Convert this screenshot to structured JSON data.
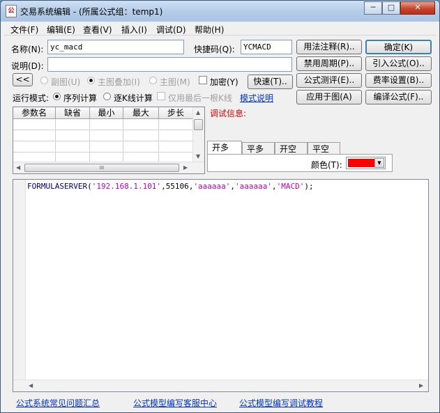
{
  "window": {
    "title": "交易系统编辑 - (所属公式组：temp1)",
    "icon_text": "公"
  },
  "window_controls": {
    "minimize": "─",
    "maximize": "□",
    "close": "✕"
  },
  "menu": [
    "文件(F)",
    "编辑(E)",
    "查看(V)",
    "插入(I)",
    "调试(D)",
    "帮助(H)"
  ],
  "form": {
    "name_label": "名称(N):",
    "name_value": "yc_macd",
    "shortcut_label": "快捷码(Q):",
    "shortcut_value": "YCMACD",
    "desc_label": "说明(D):",
    "desc_value": "",
    "collapse_button": "<<",
    "radio_subchart": "副图(U)",
    "radio_main_overlay": "主图叠加(I)",
    "radio_main": "主图(M)",
    "encrypt_label": "加密(Y)",
    "fast_button": "快速(T)..",
    "mode_label": "运行模式:",
    "mode_sequence": "序列计算",
    "mode_bar": "逐K线计算",
    "last_bar_only": "仅用最后一根K线",
    "mode_help_link": "模式说明"
  },
  "right_buttons": {
    "usage_notes": "用法注释(R)..",
    "confirm": "确定(K)",
    "disable_period": "禁用周期(P)..",
    "import_formula": "引入公式(O)..",
    "formula_test": "公式测评(E)..",
    "fee_setting": "费率设置(B)..",
    "apply_to_chart": "应用于图(A)",
    "compile_formula": "编译公式(F).."
  },
  "param_table": {
    "columns": [
      "参数名",
      "缺省",
      "最小",
      "最大",
      "步长"
    ]
  },
  "debug": {
    "label": "调试信息:"
  },
  "signal_tabs": [
    "开多",
    "平多",
    "开空",
    "平空"
  ],
  "color_label": "颜色(T):",
  "colors": {
    "signal_color": "#ff0000"
  },
  "scroll_icons": {
    "up": "▲",
    "down": "▼",
    "left": "◀",
    "right": "▶",
    "grip": "III",
    "drop": "▼"
  },
  "code": {
    "fn": "FORMULASERVER",
    "open": "(",
    "s_ip": "'192.168.1.101'",
    "c1": ",",
    "port": "55106",
    "c2": ",",
    "s_user": "'aaaaaa'",
    "c3": ",",
    "s_pass": "'aaaaaa'",
    "c4": ",",
    "s_name": "'MACD'",
    "close": ");"
  },
  "footer_links": [
    "公式系统常见问题汇总",
    "公式模型编写客服中心",
    "公式模型编写调试教程"
  ]
}
